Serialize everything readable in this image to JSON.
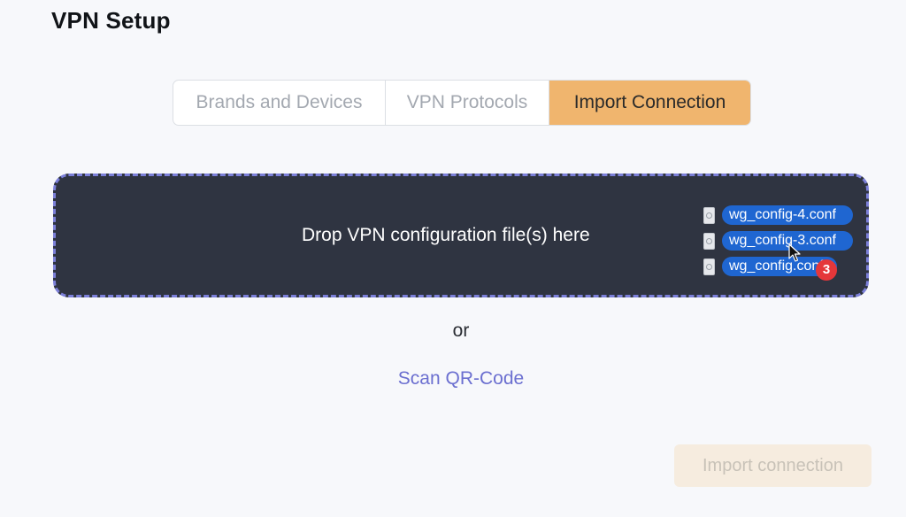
{
  "page": {
    "title": "VPN Setup"
  },
  "tabs": [
    {
      "label": "Brands and Devices",
      "active": false
    },
    {
      "label": "VPN Protocols",
      "active": false
    },
    {
      "label": "Import Connection",
      "active": true
    }
  ],
  "dropzone": {
    "text": "Drop VPN configuration file(s) here",
    "dragged_files": [
      {
        "name": "wg_config-4.conf",
        "icon": "config-file-icon"
      },
      {
        "name": "wg_config-3.conf",
        "icon": "config-file-icon"
      },
      {
        "name": "wg_config.conf",
        "icon": "config-file-icon"
      }
    ],
    "dragged_count": "3"
  },
  "separator": {
    "text": "or"
  },
  "scan_link": {
    "label": "Scan QR-Code"
  },
  "import_button": {
    "label": "Import connection",
    "disabled": true
  },
  "colors": {
    "accent_tab": "#f0b56e",
    "dropzone_bg": "#2f3441",
    "dropzone_border": "#7b7fd8",
    "link": "#6b6fd0",
    "file_chip": "#1f66d1",
    "badge": "#e5373a"
  }
}
